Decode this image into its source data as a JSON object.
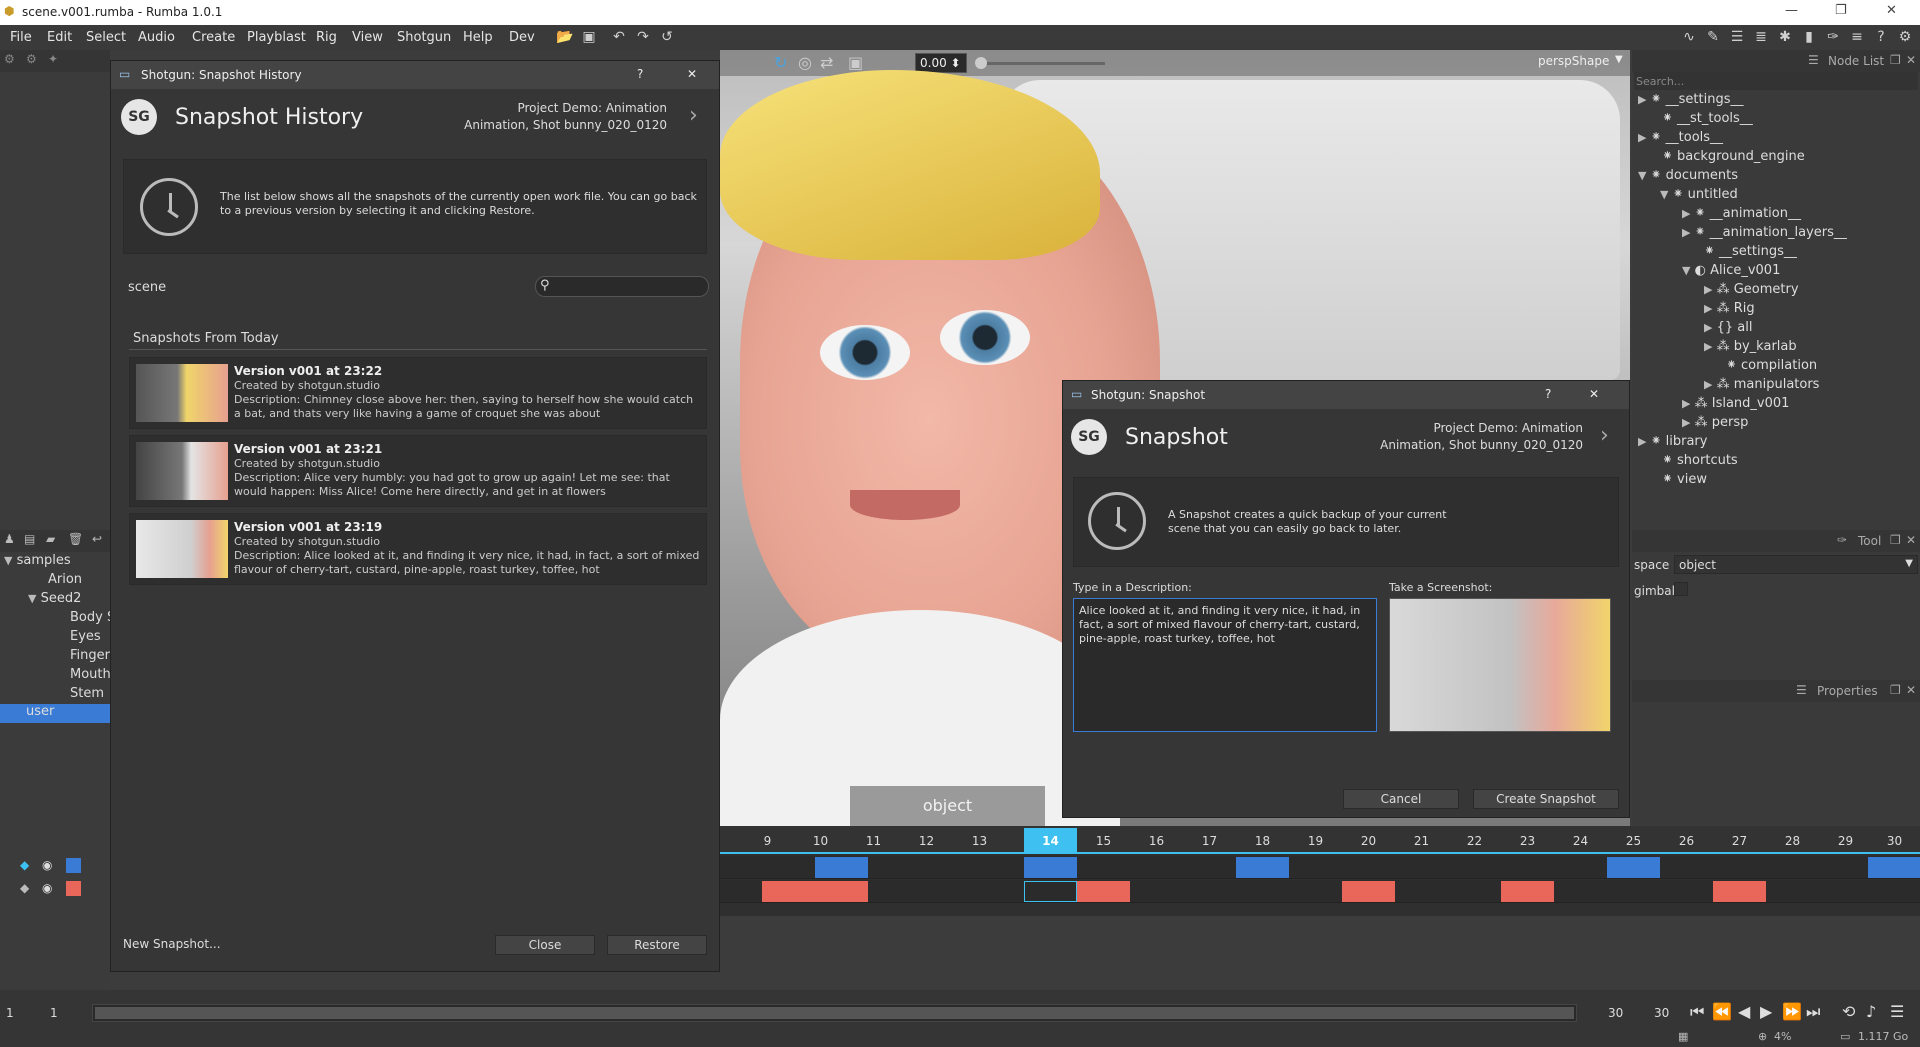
{
  "window": {
    "title": "scene.v001.rumba - Rumba 1.0.1"
  },
  "menubar": {
    "items": [
      "File",
      "Edit",
      "Select",
      "Audio",
      "Create",
      "Playblast",
      "Rig",
      "View",
      "Shotgun",
      "Help",
      "Dev"
    ]
  },
  "viewport": {
    "camera_label": "perspShape",
    "time_value": "0.00",
    "object_tab": "object"
  },
  "snapshot_history": {
    "window_title": "Shotgun: Snapshot History",
    "help": "?",
    "close_x": "✕",
    "logo": "SG",
    "heading": "Snapshot History",
    "project_line1": "Project Demo: Animation",
    "project_line2": "Animation, Shot bunny_020_0120",
    "info_text": "The list below shows all the snapshots of the currently open work file.  You can go back to a previous version by selecting it and clicking Restore.",
    "scene_label": "scene",
    "search_placeholder": "",
    "section_title": "Snapshots From Today",
    "snapshots": [
      {
        "title": "Version v001 at 23:22",
        "creator": "Created by shotgun.studio",
        "description": "Description: Chimney close above her: then, saying to herself how she would catch a bat, and thats very like having a game of croquet she was about"
      },
      {
        "title": "Version v001 at 23:21",
        "creator": "Created by shotgun.studio",
        "description": "Description: Alice very humbly: you had got to grow up again! Let me see: that would happen: Miss Alice! Come here directly, and get in at flowers"
      },
      {
        "title": "Version v001 at 23:19",
        "creator": "Created by shotgun.studio",
        "description": "Description: Alice looked at it, and finding it very nice, it had, in fact, a sort of mixed flavour of cherry-tart, custard, pine-apple, roast turkey, toffee, hot"
      }
    ],
    "new_snapshot": "New Snapshot...",
    "close": "Close",
    "restore": "Restore"
  },
  "snapshot": {
    "window_title": "Shotgun: Snapshot",
    "help": "?",
    "close_x": "✕",
    "logo": "SG",
    "heading": "Snapshot",
    "project_line1": "Project Demo: Animation",
    "project_line2": "Animation, Shot bunny_020_0120",
    "info_text": "A Snapshot creates a quick backup of your current scene that you can easily go back to later.",
    "description_label": "Type in a Description:",
    "description_value": "Alice looked at it, and finding it very nice, it had, in fact, a sort of mixed flavour of cherry-tart, custard, pine-apple, roast turkey, toffee, hot",
    "screenshot_label": "Take a Screenshot:",
    "cancel": "Cancel",
    "create": "Create Snapshot"
  },
  "outliner": {
    "items": [
      {
        "label": "samples"
      },
      {
        "label": "Arion"
      },
      {
        "label": "Seed2"
      },
      {
        "label": "Body S"
      },
      {
        "label": "Eyes"
      },
      {
        "label": "Finger"
      },
      {
        "label": "Mouth"
      },
      {
        "label": "Stem"
      },
      {
        "label": "user"
      }
    ]
  },
  "node_list": {
    "title": "Node List",
    "search_placeholder": "Search...",
    "nodes": [
      {
        "label": "__settings__"
      },
      {
        "label": "__st_tools__"
      },
      {
        "label": "__tools__"
      },
      {
        "label": "background_engine"
      },
      {
        "label": "documents"
      },
      {
        "label": "untitled"
      },
      {
        "label": "__animation__"
      },
      {
        "label": "__animation_layers__"
      },
      {
        "label": "__settings__"
      },
      {
        "label": "Alice_v001"
      },
      {
        "label": "Geometry"
      },
      {
        "label": "Rig"
      },
      {
        "label": "all"
      },
      {
        "label": "by_karlab"
      },
      {
        "label": "compilation"
      },
      {
        "label": "manipulators"
      },
      {
        "label": "Island_v001"
      },
      {
        "label": "persp"
      },
      {
        "label": "library"
      },
      {
        "label": "shortcuts"
      },
      {
        "label": "view"
      }
    ]
  },
  "tool_panel": {
    "title": "Tool",
    "space_label": "space",
    "space_value": "object",
    "gimbal_label": "gimbal"
  },
  "properties_panel": {
    "title": "Properties"
  },
  "timeline": {
    "frames": [
      "9",
      "10",
      "11",
      "12",
      "13",
      "14",
      "15",
      "16",
      "17",
      "18",
      "19",
      "20",
      "21",
      "22",
      "23",
      "24",
      "25",
      "26",
      "27",
      "28",
      "29",
      "30"
    ],
    "current_frame": "14",
    "blue_key_color": "#3a7bd5",
    "red_key_color": "#e8675a"
  },
  "bottom": {
    "start": "1",
    "start2": "1",
    "end": "30",
    "end2": "30",
    "zoom": "4%",
    "memory": "1.117 Go"
  }
}
